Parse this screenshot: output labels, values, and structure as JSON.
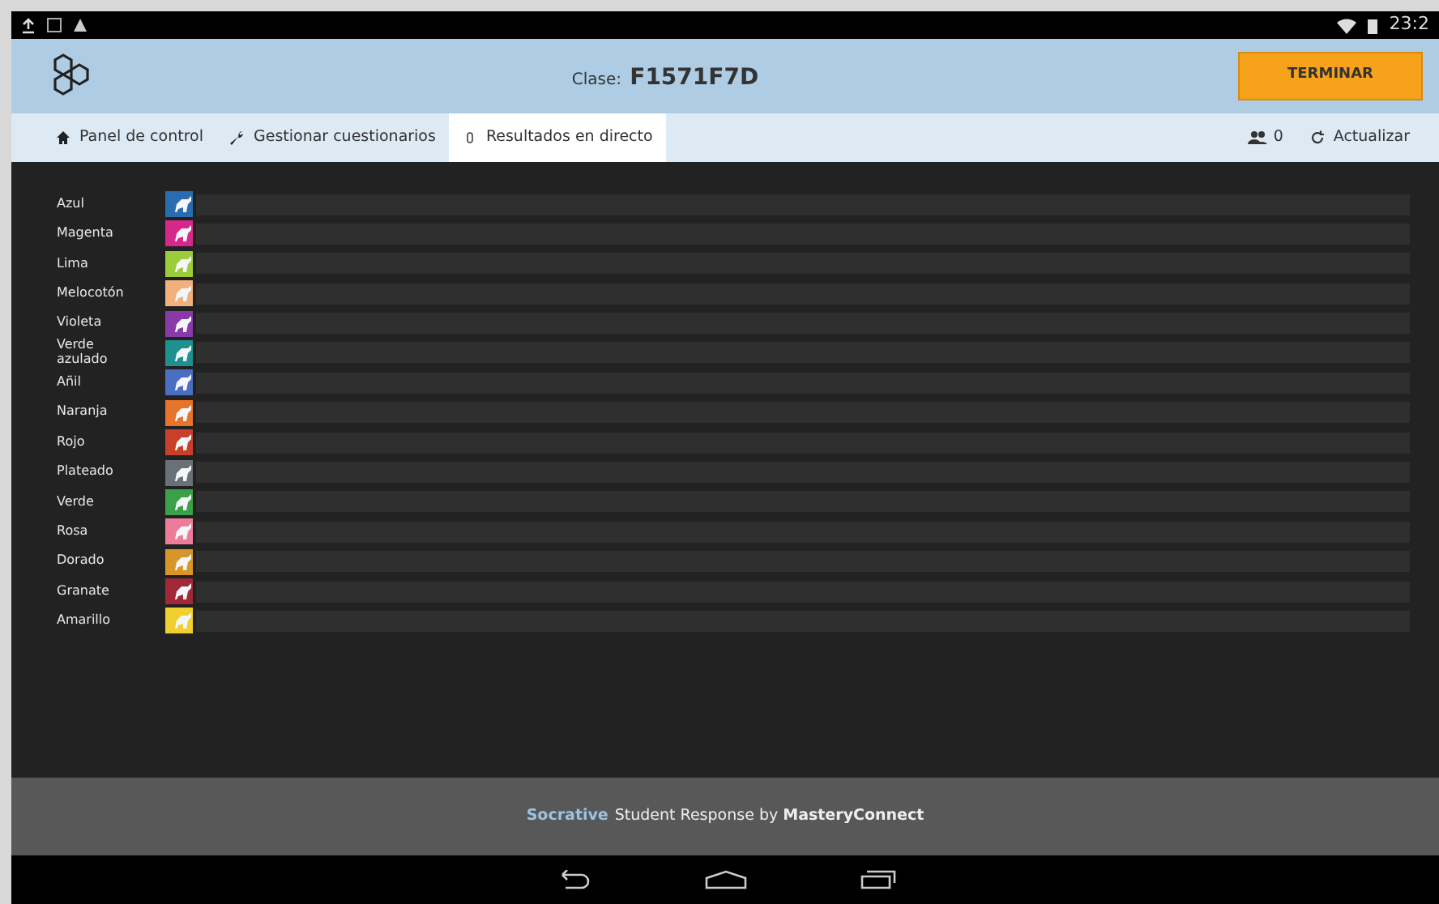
{
  "status_bar": {
    "time": "23:2"
  },
  "header": {
    "class_label": "Clase:",
    "class_code": "F1571F7D",
    "finish_button": "TERMINAR"
  },
  "tabs": [
    {
      "label": "Panel de control",
      "selected": false
    },
    {
      "label": "Gestionar cuestionarios",
      "selected": false
    },
    {
      "label": "Resultados en directo",
      "selected": true
    }
  ],
  "students": {
    "count": "0"
  },
  "refresh": {
    "label": "Actualizar"
  },
  "teams": [
    {
      "name": "Azul",
      "color": "#2a6cb0"
    },
    {
      "name": "Magenta",
      "color": "#d6288a"
    },
    {
      "name": "Lima",
      "color": "#9ccc3a"
    },
    {
      "name": "Melocotón",
      "color": "#f2b07c"
    },
    {
      "name": "Violeta",
      "color": "#8a3aa8"
    },
    {
      "name": "Verde azulado",
      "color": "#1e9090"
    },
    {
      "name": "Añil",
      "color": "#4a6ec0"
    },
    {
      "name": "Naranja",
      "color": "#e8732a"
    },
    {
      "name": "Rojo",
      "color": "#c8402a"
    },
    {
      "name": "Plateado",
      "color": "#6a7078"
    },
    {
      "name": "Verde",
      "color": "#3aa04a"
    },
    {
      "name": "Rosa",
      "color": "#ec7c9a"
    },
    {
      "name": "Dorado",
      "color": "#d8962a"
    },
    {
      "name": "Granate",
      "color": "#a02838"
    },
    {
      "name": "Amarillo",
      "color": "#f0d030"
    }
  ],
  "footer": {
    "brand": "Socrative",
    "text": "Student Response by **MasteryConnect**"
  }
}
